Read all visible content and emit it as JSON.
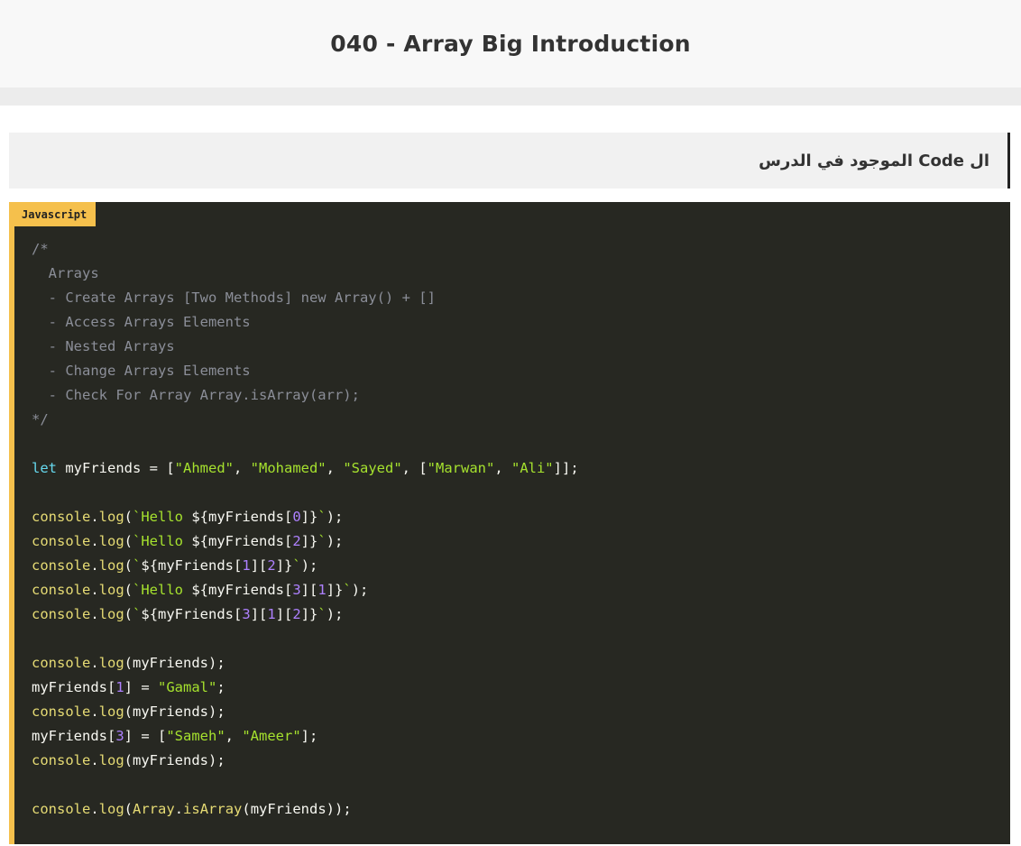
{
  "header": {
    "title": "040 - Array Big Introduction"
  },
  "section": {
    "title": "ال Code الموجود في الدرس"
  },
  "code_block": {
    "language": "Javascript",
    "lines": [
      [
        [
          "c",
          "/*"
        ]
      ],
      [
        [
          "c",
          "  Arrays"
        ]
      ],
      [
        [
          "c",
          "  - Create Arrays [Two Methods] new Array() + []"
        ]
      ],
      [
        [
          "c",
          "  - Access Arrays Elements"
        ]
      ],
      [
        [
          "c",
          "  - Nested Arrays"
        ]
      ],
      [
        [
          "c",
          "  - Change Arrays Elements"
        ]
      ],
      [
        [
          "c",
          "  - Check For Array Array.isArray(arr);"
        ]
      ],
      [
        [
          "c",
          "*/"
        ]
      ],
      [],
      [
        [
          "k",
          "let"
        ],
        [
          "p",
          " myFriends = ["
        ],
        [
          "s",
          "\"Ahmed\""
        ],
        [
          "p",
          ", "
        ],
        [
          "s",
          "\"Mohamed\""
        ],
        [
          "p",
          ", "
        ],
        [
          "s",
          "\"Sayed\""
        ],
        [
          "p",
          ", ["
        ],
        [
          "s",
          "\"Marwan\""
        ],
        [
          "p",
          ", "
        ],
        [
          "s",
          "\"Ali\""
        ],
        [
          "p",
          "]];"
        ]
      ],
      [],
      [
        [
          "f",
          "console"
        ],
        [
          "p",
          "."
        ],
        [
          "f",
          "log"
        ],
        [
          "p",
          "("
        ],
        [
          "s",
          "`Hello "
        ],
        [
          "p",
          "${myFriends["
        ],
        [
          "n",
          "0"
        ],
        [
          "p",
          "]}"
        ],
        [
          "s",
          "`"
        ],
        [
          "p",
          ");"
        ]
      ],
      [
        [
          "f",
          "console"
        ],
        [
          "p",
          "."
        ],
        [
          "f",
          "log"
        ],
        [
          "p",
          "("
        ],
        [
          "s",
          "`Hello "
        ],
        [
          "p",
          "${myFriends["
        ],
        [
          "n",
          "2"
        ],
        [
          "p",
          "]}"
        ],
        [
          "s",
          "`"
        ],
        [
          "p",
          ");"
        ]
      ],
      [
        [
          "f",
          "console"
        ],
        [
          "p",
          "."
        ],
        [
          "f",
          "log"
        ],
        [
          "p",
          "("
        ],
        [
          "s",
          "`"
        ],
        [
          "p",
          "${myFriends["
        ],
        [
          "n",
          "1"
        ],
        [
          "p",
          "]["
        ],
        [
          "n",
          "2"
        ],
        [
          "p",
          "]}"
        ],
        [
          "s",
          "`"
        ],
        [
          "p",
          ");"
        ]
      ],
      [
        [
          "f",
          "console"
        ],
        [
          "p",
          "."
        ],
        [
          "f",
          "log"
        ],
        [
          "p",
          "("
        ],
        [
          "s",
          "`Hello "
        ],
        [
          "p",
          "${myFriends["
        ],
        [
          "n",
          "3"
        ],
        [
          "p",
          "]["
        ],
        [
          "n",
          "1"
        ],
        [
          "p",
          "]}"
        ],
        [
          "s",
          "`"
        ],
        [
          "p",
          ");"
        ]
      ],
      [
        [
          "f",
          "console"
        ],
        [
          "p",
          "."
        ],
        [
          "f",
          "log"
        ],
        [
          "p",
          "("
        ],
        [
          "s",
          "`"
        ],
        [
          "p",
          "${myFriends["
        ],
        [
          "n",
          "3"
        ],
        [
          "p",
          "]["
        ],
        [
          "n",
          "1"
        ],
        [
          "p",
          "]["
        ],
        [
          "n",
          "2"
        ],
        [
          "p",
          "]}"
        ],
        [
          "s",
          "`"
        ],
        [
          "p",
          ");"
        ]
      ],
      [],
      [
        [
          "f",
          "console"
        ],
        [
          "p",
          "."
        ],
        [
          "f",
          "log"
        ],
        [
          "p",
          "(myFriends);"
        ]
      ],
      [
        [
          "p",
          "myFriends["
        ],
        [
          "n",
          "1"
        ],
        [
          "p",
          "] = "
        ],
        [
          "s",
          "\"Gamal\""
        ],
        [
          "p",
          ";"
        ]
      ],
      [
        [
          "f",
          "console"
        ],
        [
          "p",
          "."
        ],
        [
          "f",
          "log"
        ],
        [
          "p",
          "(myFriends);"
        ]
      ],
      [
        [
          "p",
          "myFriends["
        ],
        [
          "n",
          "3"
        ],
        [
          "p",
          "] = ["
        ],
        [
          "s",
          "\"Sameh\""
        ],
        [
          "p",
          ", "
        ],
        [
          "s",
          "\"Ameer\""
        ],
        [
          "p",
          "];"
        ]
      ],
      [
        [
          "f",
          "console"
        ],
        [
          "p",
          "."
        ],
        [
          "f",
          "log"
        ],
        [
          "p",
          "(myFriends);"
        ]
      ],
      [],
      [
        [
          "f",
          "console"
        ],
        [
          "p",
          "."
        ],
        [
          "f",
          "log"
        ],
        [
          "p",
          "("
        ],
        [
          "f",
          "Array"
        ],
        [
          "p",
          "."
        ],
        [
          "f",
          "isArray"
        ],
        [
          "p",
          "(myFriends));"
        ]
      ]
    ]
  }
}
